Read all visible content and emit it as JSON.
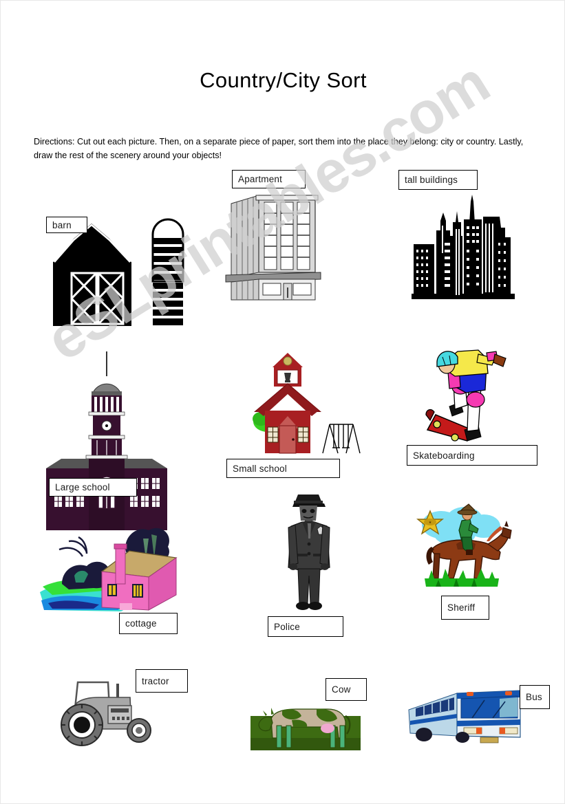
{
  "worksheet": {
    "title": "Country/City Sort",
    "directions": "Directions: Cut out each picture.  Then, on a separate piece of paper, sort them into the place they belong: city or country.   Lastly, draw the rest of the scenery around your objects!",
    "watermark": "eSLprintables.com"
  },
  "items": [
    {
      "id": "barn",
      "label": "barn",
      "picture": "black-barn-with-silo"
    },
    {
      "id": "apartment",
      "label": "Apartment",
      "picture": "grey-apartment-building"
    },
    {
      "id": "tall-buildings",
      "label": "tall buildings",
      "picture": "black-city-skyline"
    },
    {
      "id": "large-school",
      "label": "Large school",
      "picture": "purple-colonial-school-with-clock-tower"
    },
    {
      "id": "small-school",
      "label": "Small school",
      "picture": "red-schoolhouse-with-tree-and-swings"
    },
    {
      "id": "skateboarding",
      "label": "Skateboarding",
      "picture": "boy-on-skateboard"
    },
    {
      "id": "cottage",
      "label": "cottage",
      "picture": "pink-cottage-in-landscape"
    },
    {
      "id": "police",
      "label": "Police",
      "picture": "police-officer-standing"
    },
    {
      "id": "sheriff",
      "label": "Sheriff",
      "picture": "sheriff-on-horseback-with-star-badge"
    },
    {
      "id": "tractor",
      "label": "tractor",
      "picture": "grey-farm-tractor"
    },
    {
      "id": "cow",
      "label": "Cow",
      "picture": "cow-in-green-field"
    },
    {
      "id": "bus",
      "label": "Bus",
      "picture": "blue-and-white-city-bus"
    }
  ],
  "colors": {
    "barn_black": "#000000",
    "apartment_grey": "#c8c8c8",
    "skyline_black": "#000000",
    "large_school_purple": "#37102f",
    "small_school_red": "#a81f22",
    "tree_green": "#39d122",
    "skate_helmet": "#46d9e0",
    "skate_shirt": "#f5e84a",
    "skate_shorts": "#1a28d8",
    "skate_pads": "#f53ab2",
    "skate_board": "#c41a1a",
    "cottage_pink": "#f06ec0",
    "cottage_roof": "#c7a96a",
    "police_grey": "#3a3a3a",
    "sheriff_horse": "#8c3a14",
    "sheriff_star": "#e8c020",
    "sky_cyan": "#7fe0f5",
    "grass_green": "#19b319",
    "tractor_grey": "#a8a8a8",
    "cow_field": "#3d6b12",
    "cow_body": "#c4b39a",
    "bus_blue": "#1555b0",
    "bus_light": "#bcd8e8"
  }
}
